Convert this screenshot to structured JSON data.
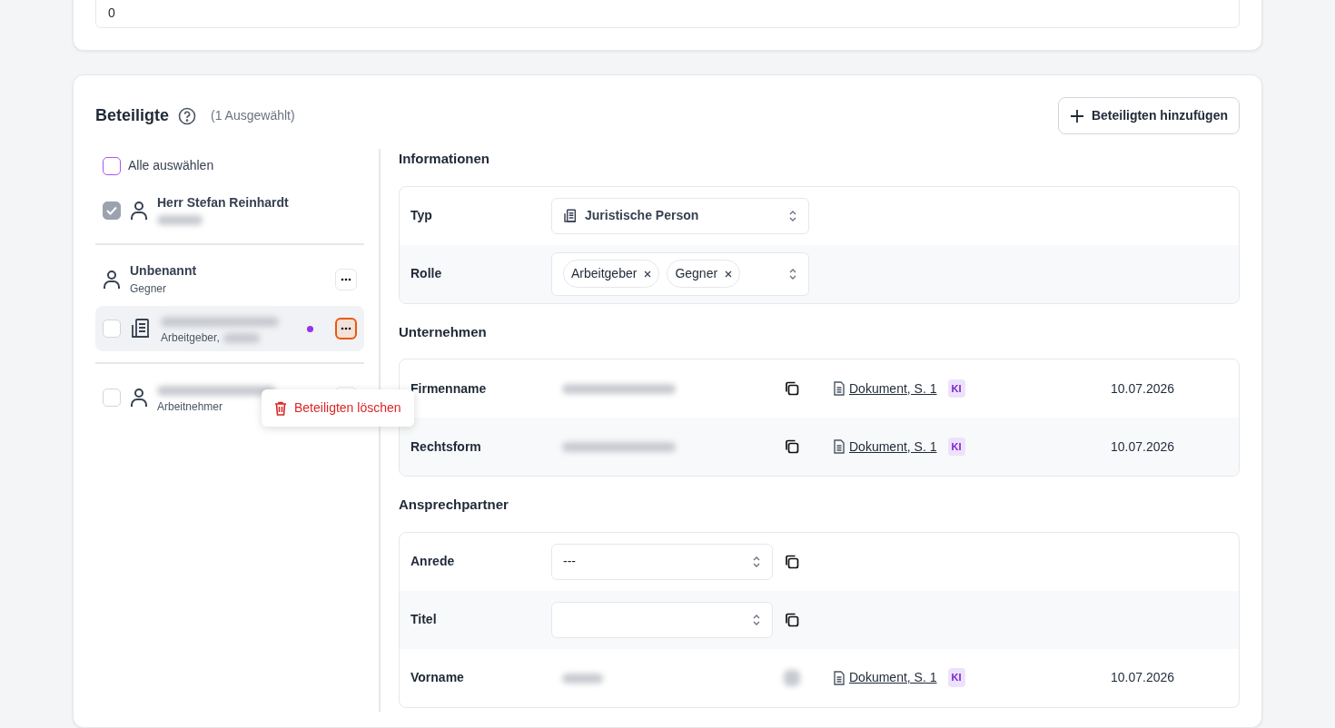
{
  "top_field": {
    "value": "0"
  },
  "section": {
    "title": "Beteiligte",
    "selected_count": "(1 Ausgewählt)",
    "add_button": "Beteiligten hinzufügen"
  },
  "select_all": {
    "label": "Alle auswählen",
    "checked": false
  },
  "groups": [
    {
      "items": [
        {
          "kind": "person",
          "title": "Herr Stefan Reinhardt",
          "subtitle_blurred": true,
          "checked": true,
          "selected": false
        }
      ]
    },
    {
      "header": {
        "kind": "person",
        "title": "Unbenannt",
        "subtitle": "Gegner",
        "menu_button": true
      },
      "items": [
        {
          "kind": "company",
          "title_blurred": true,
          "subtitle": "Arbeitgeber,",
          "subtitle_blurred": true,
          "checked": false,
          "selected": true,
          "color": "#9333ea",
          "menu_button": true,
          "menu_focused": true
        }
      ]
    },
    {
      "items": [
        {
          "kind": "person",
          "title_blurred": true,
          "subtitle": "Arbeitnehmer",
          "checked": false,
          "selected": false,
          "menu_button": true,
          "context_menu": [
            {
              "kind": "danger",
              "label": "Beteiligten löschen"
            }
          ]
        }
      ]
    }
  ],
  "panels": [
    {
      "title": "Informationen",
      "rows": [
        {
          "kind": "select",
          "label": "Typ",
          "value": "Juristische Person",
          "has_icon": true
        },
        {
          "kind": "multiselect",
          "label": "Rolle",
          "chips": [
            "Arbeitgeber",
            "Gegner"
          ]
        }
      ]
    },
    {
      "title": "Unternehmen",
      "rows": [
        {
          "kind": "extracted",
          "label": "Firmenname",
          "value_blurred": true,
          "copy": true,
          "source": "Dokument, S. 1",
          "badge": "KI",
          "date": "10.07.2026"
        },
        {
          "kind": "extracted",
          "label": "Rechtsform",
          "value_blurred": true,
          "copy": true,
          "source": "Dokument, S. 1",
          "badge": "KI",
          "date": "10.07.2026"
        }
      ]
    },
    {
      "title": "Ansprechpartner",
      "rows": [
        {
          "kind": "select",
          "label": "Anrede",
          "value": "---",
          "copy": true
        },
        {
          "kind": "select",
          "label": "Titel",
          "copy": true
        },
        {
          "kind": "extracted",
          "label": "Vorname",
          "value_blurred": true,
          "copy_blurred": true,
          "source": "Dokument, S. 1",
          "badge": "KI",
          "date": "10.07.2026"
        }
      ]
    }
  ]
}
